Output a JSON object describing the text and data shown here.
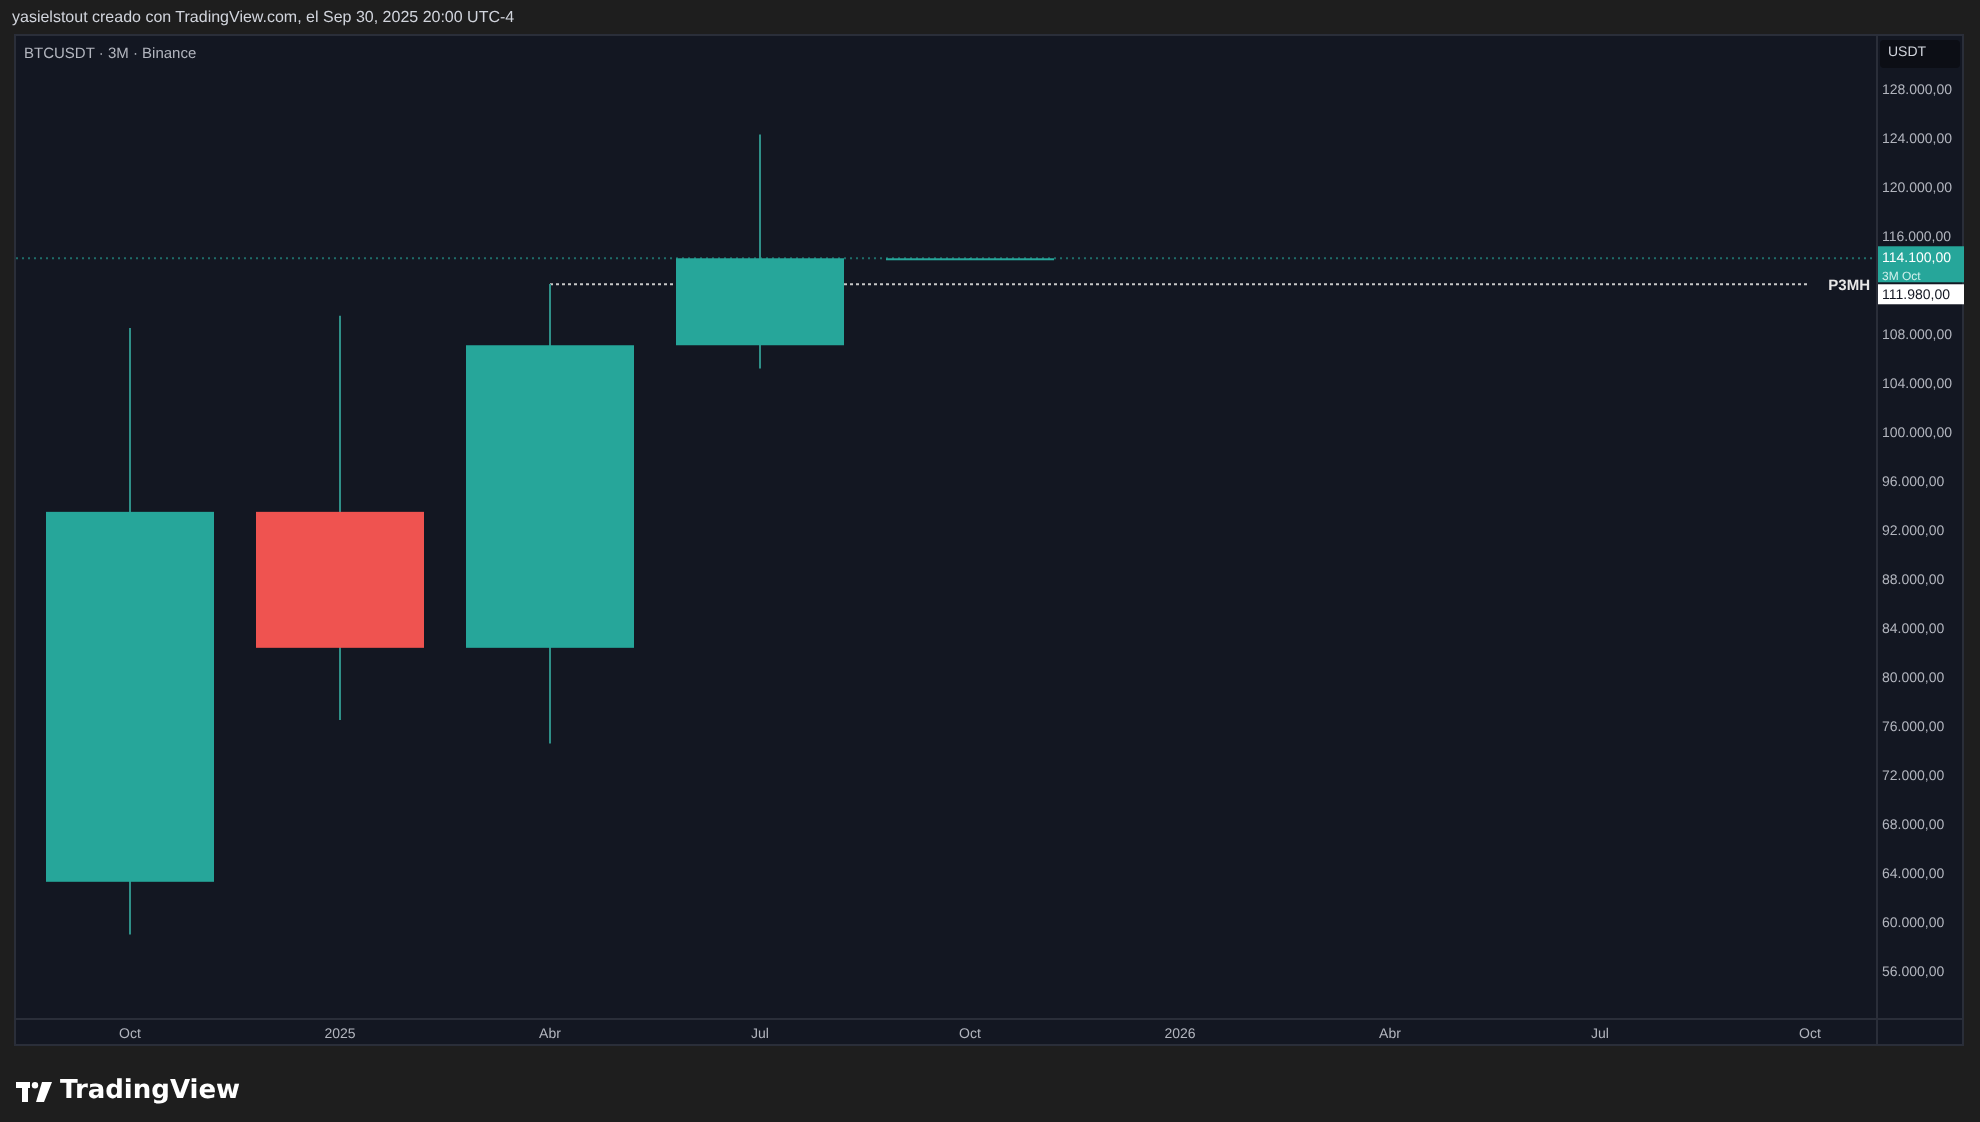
{
  "header": {
    "text": "yasielstout creado con TradingView.com, el Sep 30, 2025 20:00 UTC-4"
  },
  "chart": {
    "legend": "BTCUSDT · 3M · Binance",
    "currency_button": "USDT",
    "price_axis_labels": [
      "128.000,00",
      "124.000,00",
      "120.000,00",
      "116.000,00",
      "108.000,00",
      "104.000,00",
      "100.000,00",
      "96.000,00",
      "92.000,00",
      "88.000,00",
      "84.000,00",
      "80.000,00",
      "76.000,00",
      "72.000,00",
      "68.000,00",
      "64.000,00",
      "60.000,00",
      "56.000,00"
    ],
    "time_axis_labels": [
      "Oct",
      "2025",
      "Abr",
      "Jul",
      "Oct",
      "2026",
      "Abr",
      "Jul",
      "Oct"
    ],
    "last_price": {
      "label": "114.100,00",
      "sublabel": "3M Oct"
    },
    "level_line": {
      "label": "P3MH",
      "price_label": "111.980,00"
    }
  },
  "footer": {
    "brand": "TradingView"
  }
}
